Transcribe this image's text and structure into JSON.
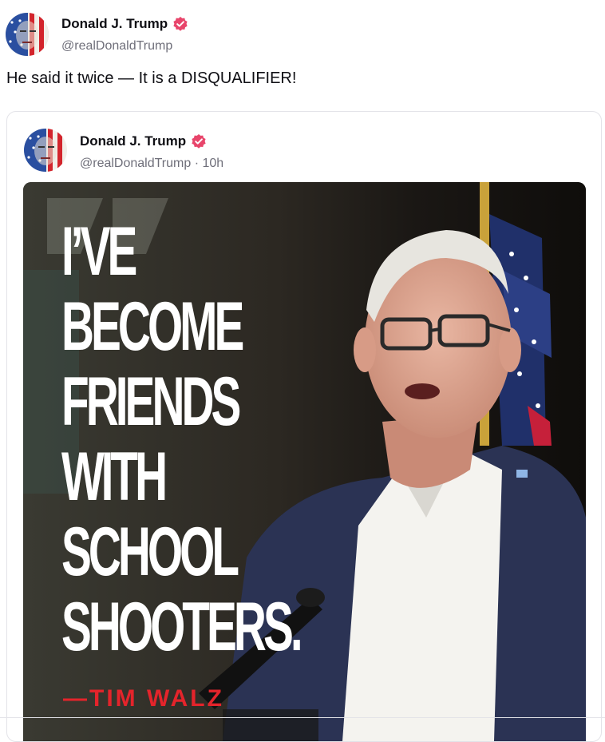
{
  "post": {
    "author": {
      "display_name": "Donald J. Trump",
      "handle": "@realDonaldTrump",
      "verified_icon": "verified-badge-icon",
      "avatar": "avatar-image"
    },
    "text": "He said it twice — It is a DISQUALIFIER!"
  },
  "quoted_post": {
    "author": {
      "display_name": "Donald J. Trump",
      "handle_time": "@realDonaldTrump · 10h",
      "verified_icon": "verified-badge-icon"
    },
    "media": {
      "headline_lines": [
        "I’VE",
        "BECOME",
        "FRIENDS",
        "WITH",
        "SCHOOL",
        "SHOOTERS."
      ],
      "attribution": "—TIM WALZ"
    }
  },
  "colors": {
    "verified_badge": "#e8456b",
    "attribution_red": "#e4242b",
    "text_primary": "#0f0f14",
    "text_secondary": "#6f6f7a",
    "card_border": "#e3e3e8"
  }
}
